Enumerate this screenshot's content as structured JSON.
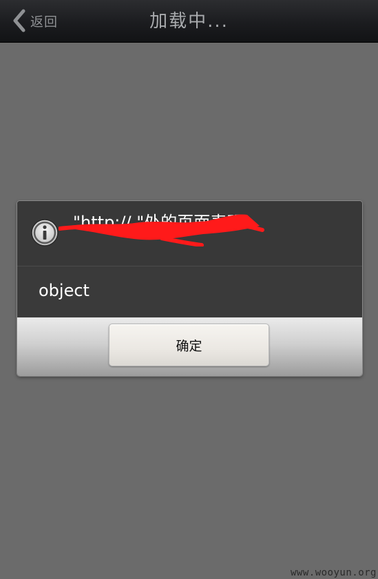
{
  "topbar": {
    "back_label": "返回",
    "title": "加载中..."
  },
  "dialog": {
    "title": "\"http://                         \"处的页面表明：",
    "message": "object",
    "confirm_label": "确定",
    "icon": "info-icon",
    "redaction_color": "#ff1a1a"
  },
  "watermark": "www.wooyun.org",
  "colors": {
    "background": "#6b6b6b",
    "topbar": "#1b1c1f",
    "dialog": "#3a3a3a"
  }
}
